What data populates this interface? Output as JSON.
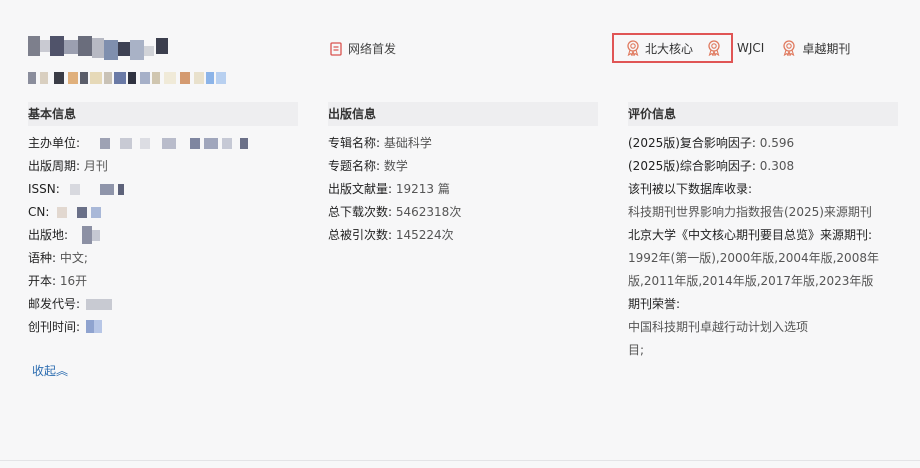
{
  "header": {
    "first_publish": "网络首发",
    "badges": [
      "北大核心",
      "WJCI",
      "卓越期刊"
    ]
  },
  "basic": {
    "title": "基本信息",
    "rows": [
      {
        "label": "主办单位:",
        "value": ""
      },
      {
        "label": "出版周期:",
        "value": "月刊"
      },
      {
        "label": "ISSN:",
        "value": ""
      },
      {
        "label": "CN:",
        "value": ""
      },
      {
        "label": "出版地:",
        "value": ""
      },
      {
        "label": "语种:",
        "value": "中文;"
      },
      {
        "label": "开本:",
        "value": "16开"
      },
      {
        "label": "邮发代号:",
        "value": ""
      },
      {
        "label": "创刊时间:",
        "value": ""
      }
    ],
    "collapse": "收起"
  },
  "publish": {
    "title": "出版信息",
    "rows": [
      {
        "label": "专辑名称:",
        "value": "基础科学"
      },
      {
        "label": "专题名称:",
        "value": "数学"
      },
      {
        "label": "出版文献量:",
        "value": "19213 篇"
      },
      {
        "label": "总下载次数:",
        "value": "5462318次"
      },
      {
        "label": "总被引次数:",
        "value": "145224次"
      }
    ]
  },
  "evaluation": {
    "title": "评价信息",
    "impact_composite": "(2025版)复合影响因子:",
    "impact_composite_value": "0.596",
    "impact_comprehensive": "(2025版)综合影响因子:",
    "impact_comprehensive_value": "0.308",
    "db_label": "该刊被以下数据库收录:",
    "db_value": "科技期刊世界影响力指数报告(2025)来源期刊",
    "pku_label": "北京大学《中文核心期刊要目总览》来源期刊:",
    "pku_line1": "1992年(第一版),2000年版,2004年版,2008年",
    "pku_line2": "版,2011年版,2014年版,2017年版,2023年版",
    "honor_label": "期刊荣誉:",
    "honor_line1": "中国科技期刊卓越行动计划入选项",
    "honor_line2": "目;"
  }
}
